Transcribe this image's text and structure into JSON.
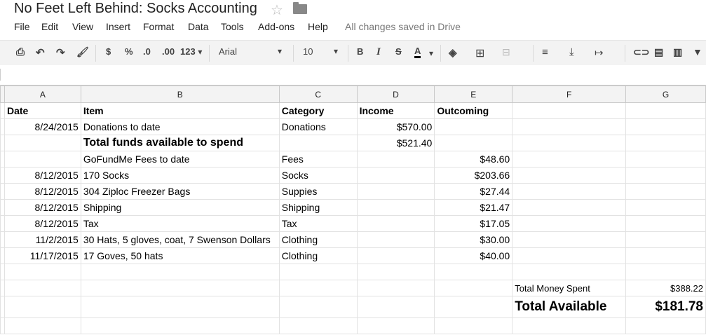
{
  "doc": {
    "title": "No Feet Left Behind: Socks Accounting"
  },
  "menu": {
    "items": [
      "File",
      "Edit",
      "View",
      "Insert",
      "Format",
      "Data",
      "Tools",
      "Add-ons",
      "Help"
    ],
    "status": "All changes saved in Drive"
  },
  "toolbar": {
    "currency": "$",
    "percent": "%",
    "dec_less": ".0",
    "dec_more": ".00",
    "more_formats": "123",
    "font": "Arial",
    "size": "10",
    "bold": "B",
    "italic": "I",
    "strike": "S",
    "textcolor": "A"
  },
  "columns": [
    "A",
    "B",
    "C",
    "D",
    "E",
    "F",
    "G"
  ],
  "rows": [
    {
      "a": "Date",
      "b": "Item",
      "c": "Category",
      "d": "Income",
      "e": "Outcoming",
      "f": "",
      "g": ""
    },
    {
      "a": "8/24/2015",
      "b": "Donations to date",
      "c": "Donations",
      "d": "$570.00",
      "e": "",
      "f": "",
      "g": ""
    },
    {
      "a": "",
      "b": "Total funds available to spend",
      "c": "",
      "d": "$521.40",
      "e": "",
      "f": "",
      "g": ""
    },
    {
      "a": "",
      "b": "GoFundMe Fees to date",
      "c": "Fees",
      "d": "",
      "e": "$48.60",
      "f": "",
      "g": ""
    },
    {
      "a": "8/12/2015",
      "b": "170 Socks",
      "c": "Socks",
      "d": "",
      "e": "$203.66",
      "f": "",
      "g": ""
    },
    {
      "a": "8/12/2015",
      "b": "304 Ziploc Freezer Bags",
      "c": "Suppies",
      "d": "",
      "e": "$27.44",
      "f": "",
      "g": ""
    },
    {
      "a": "8/12/2015",
      "b": "Shipping",
      "c": "Shipping",
      "d": "",
      "e": "$21.47",
      "f": "",
      "g": ""
    },
    {
      "a": "8/12/2015",
      "b": "Tax",
      "c": "Tax",
      "d": "",
      "e": "$17.05",
      "f": "",
      "g": ""
    },
    {
      "a": "11/2/2015",
      "b": "30 Hats, 5 gloves, coat, 7 Swenson Dollars",
      "c": "Clothing",
      "d": "",
      "e": "$30.00",
      "f": "",
      "g": ""
    },
    {
      "a": "11/17/2015",
      "b": "17 Goves, 50 hats",
      "c": "Clothing",
      "d": "",
      "e": "$40.00",
      "f": "",
      "g": ""
    },
    {
      "a": "",
      "b": "",
      "c": "",
      "d": "",
      "e": "",
      "f": "",
      "g": ""
    },
    {
      "a": "",
      "b": "",
      "c": "",
      "d": "",
      "e": "",
      "f": "Total Money Spent",
      "g": "$388.22"
    },
    {
      "a": "",
      "b": "",
      "c": "",
      "d": "",
      "e": "",
      "f": "Total Available",
      "g": "$181.78"
    },
    {
      "a": "",
      "b": "",
      "c": "",
      "d": "",
      "e": "",
      "f": "",
      "g": ""
    }
  ]
}
